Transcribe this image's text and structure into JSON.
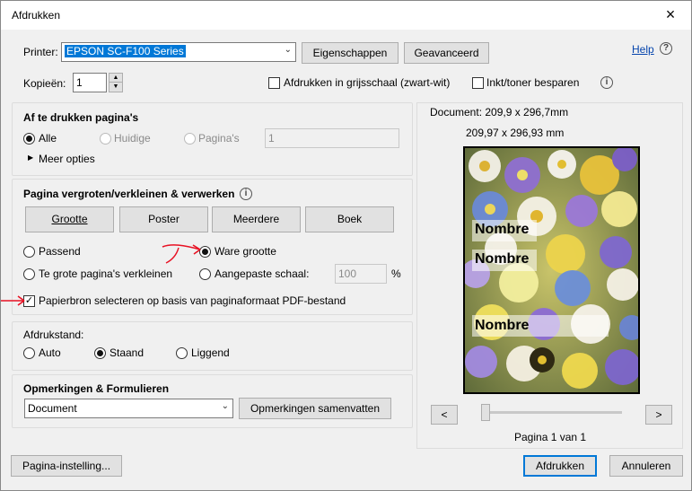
{
  "window": {
    "title": "Afdrukken",
    "close_glyph": "×"
  },
  "printer": {
    "label": "Printer:",
    "selected": "EPSON SC-F100 Series",
    "properties_button": "Eigenschappen",
    "advanced_button": "Geavanceerd",
    "help_link": "Help",
    "copies_label": "Kopieën:",
    "copies_value": "1",
    "grayscale_label": "Afdrukken in grijsschaal (zwart-wit)",
    "grayscale_checked": false,
    "save_ink_label": "Inkt/toner besparen",
    "save_ink_checked": false
  },
  "pages": {
    "title": "Af te drukken pagina's",
    "all_label": "Alle",
    "current_label": "Huidige",
    "pages_label": "Pagina's",
    "pages_value": "1",
    "selected": "all",
    "more_options": "Meer opties"
  },
  "sizing": {
    "title": "Pagina vergroten/verkleinen & verwerken",
    "buttons": [
      "Grootte",
      "Poster",
      "Meerdere",
      "Boek"
    ],
    "fit_label": "Passend",
    "actual_label": "Ware grootte",
    "shrink_label": "Te grote pagina's verkleinen",
    "custom_label": "Aangepaste schaal:",
    "custom_value": "100",
    "percent": "%",
    "selected": "actual",
    "paper_source_label": "Papierbron selecteren op basis van paginaformaat PDF-bestand",
    "paper_source_checked": true
  },
  "orientation": {
    "title": "Afdrukstand:",
    "auto_label": "Auto",
    "portrait_label": "Staand",
    "landscape_label": "Liggend",
    "selected": "portrait"
  },
  "comments": {
    "title": "Opmerkingen & Formulieren",
    "selected": "Document",
    "summarize_button": "Opmerkingen samenvatten"
  },
  "preview": {
    "document_size": "Document: 209,9 x 296,7mm",
    "page_size": "209,97 x 296,93 mm",
    "labels": [
      "Nombre",
      "Nombre",
      "Nombre"
    ],
    "prev_button": "<",
    "next_button": ">",
    "page_status": "Pagina 1 van 1"
  },
  "footer": {
    "page_setup_button": "Pagina-instelling...",
    "print_button": "Afdrukken",
    "cancel_button": "Annuleren"
  },
  "colors": {
    "accent": "#0078d7",
    "annotation_red": "#e81123",
    "link": "#0645ad"
  },
  "icons": [
    "close-icon",
    "help-icon",
    "info-icon",
    "chevron-down-icon",
    "spin-up-icon",
    "spin-down-icon",
    "triangle-right-icon"
  ]
}
